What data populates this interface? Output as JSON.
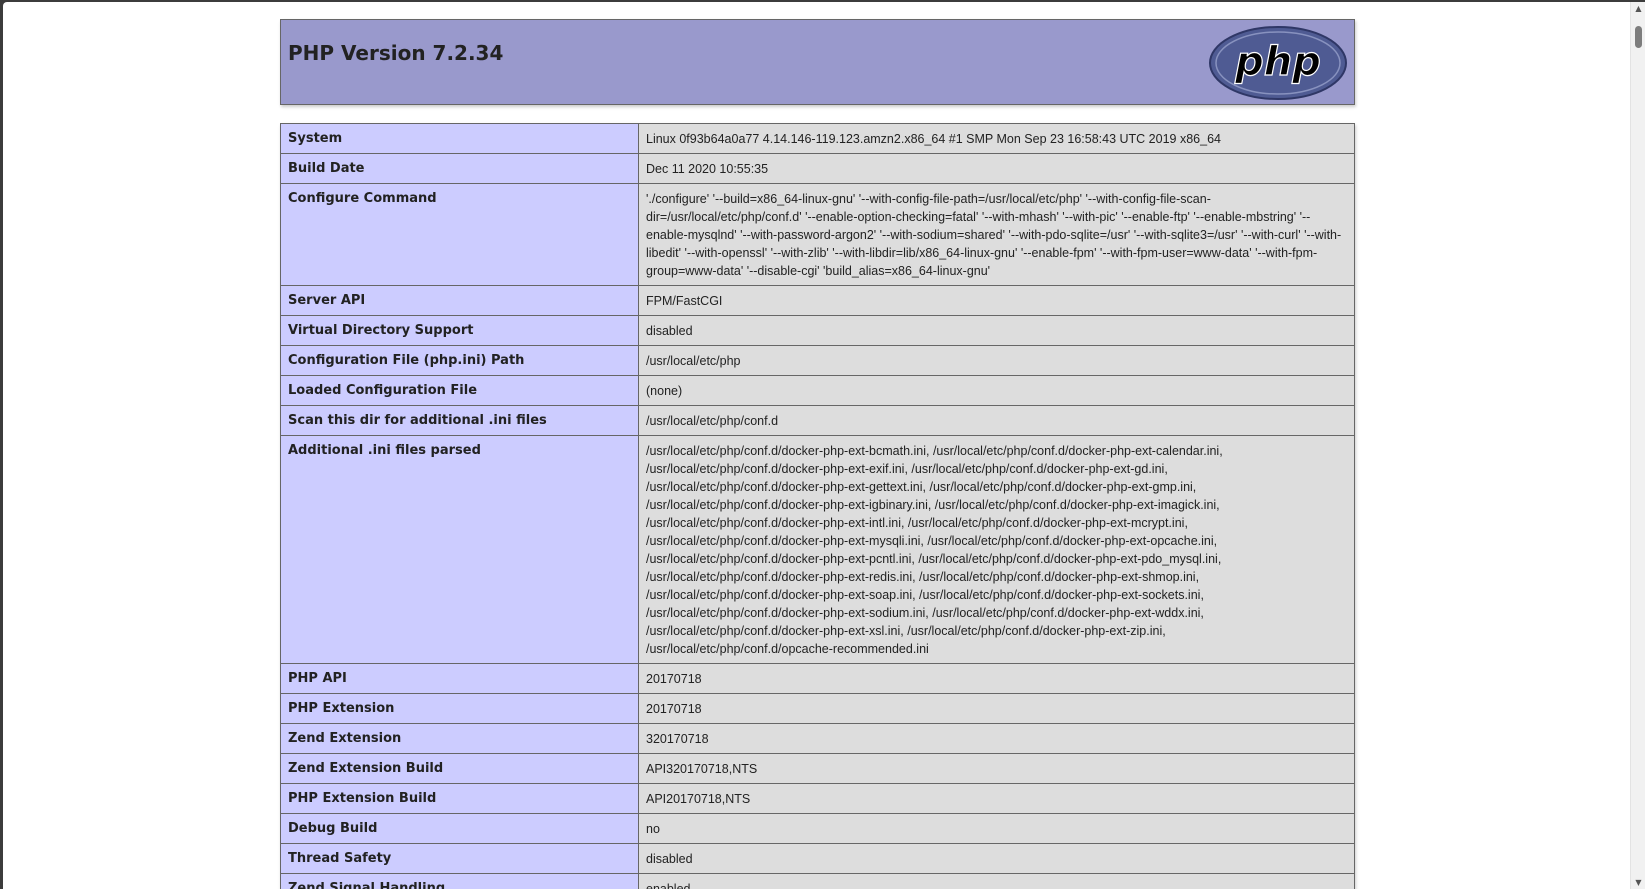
{
  "header": {
    "title": "PHP Version 7.2.34",
    "logo_text": "php"
  },
  "rows": [
    {
      "key": "System",
      "value": "Linux 0f93b64a0a77 4.14.146-119.123.amzn2.x86_64 #1 SMP Mon Sep 23 16:58:43 UTC 2019 x86_64"
    },
    {
      "key": "Build Date",
      "value": "Dec 11 2020 10:55:35"
    },
    {
      "key": "Configure Command",
      "value": "'./configure' '--build=x86_64-linux-gnu' '--with-config-file-path=/usr/local/etc/php' '--with-config-file-scan-dir=/usr/local/etc/php/conf.d' '--enable-option-checking=fatal' '--with-mhash' '--with-pic' '--enable-ftp' '--enable-mbstring' '--enable-mysqlnd' '--with-password-argon2' '--with-sodium=shared' '--with-pdo-sqlite=/usr' '--with-sqlite3=/usr' '--with-curl' '--with-libedit' '--with-openssl' '--with-zlib' '--with-libdir=lib/x86_64-linux-gnu' '--enable-fpm' '--with-fpm-user=www-data' '--with-fpm-group=www-data' '--disable-cgi' 'build_alias=x86_64-linux-gnu'"
    },
    {
      "key": "Server API",
      "value": "FPM/FastCGI"
    },
    {
      "key": "Virtual Directory Support",
      "value": "disabled"
    },
    {
      "key": "Configuration File (php.ini) Path",
      "value": "/usr/local/etc/php"
    },
    {
      "key": "Loaded Configuration File",
      "value": "(none)"
    },
    {
      "key": "Scan this dir for additional .ini files",
      "value": "/usr/local/etc/php/conf.d"
    },
    {
      "key": "Additional .ini files parsed",
      "value": "/usr/local/etc/php/conf.d/docker-php-ext-bcmath.ini, /usr/local/etc/php/conf.d/docker-php-ext-calendar.ini, /usr/local/etc/php/conf.d/docker-php-ext-exif.ini, /usr/local/etc/php/conf.d/docker-php-ext-gd.ini, /usr/local/etc/php/conf.d/docker-php-ext-gettext.ini, /usr/local/etc/php/conf.d/docker-php-ext-gmp.ini, /usr/local/etc/php/conf.d/docker-php-ext-igbinary.ini, /usr/local/etc/php/conf.d/docker-php-ext-imagick.ini, /usr/local/etc/php/conf.d/docker-php-ext-intl.ini, /usr/local/etc/php/conf.d/docker-php-ext-mcrypt.ini, /usr/local/etc/php/conf.d/docker-php-ext-mysqli.ini, /usr/local/etc/php/conf.d/docker-php-ext-opcache.ini, /usr/local/etc/php/conf.d/docker-php-ext-pcntl.ini, /usr/local/etc/php/conf.d/docker-php-ext-pdo_mysql.ini, /usr/local/etc/php/conf.d/docker-php-ext-redis.ini, /usr/local/etc/php/conf.d/docker-php-ext-shmop.ini, /usr/local/etc/php/conf.d/docker-php-ext-soap.ini, /usr/local/etc/php/conf.d/docker-php-ext-sockets.ini, /usr/local/etc/php/conf.d/docker-php-ext-sodium.ini, /usr/local/etc/php/conf.d/docker-php-ext-wddx.ini, /usr/local/etc/php/conf.d/docker-php-ext-xsl.ini, /usr/local/etc/php/conf.d/docker-php-ext-zip.ini, /usr/local/etc/php/conf.d/opcache-recommended.ini"
    },
    {
      "key": "PHP API",
      "value": "20170718"
    },
    {
      "key": "PHP Extension",
      "value": "20170718"
    },
    {
      "key": "Zend Extension",
      "value": "320170718"
    },
    {
      "key": "Zend Extension Build",
      "value": "API320170718,NTS"
    },
    {
      "key": "PHP Extension Build",
      "value": "API20170718,NTS"
    },
    {
      "key": "Debug Build",
      "value": "no"
    },
    {
      "key": "Thread Safety",
      "value": "disabled"
    },
    {
      "key": "Zend Signal Handling",
      "value": "enabled"
    }
  ],
  "colors": {
    "header_bg": "#9999cc",
    "key_bg": "#ccccff",
    "value_bg": "#dddddd"
  }
}
